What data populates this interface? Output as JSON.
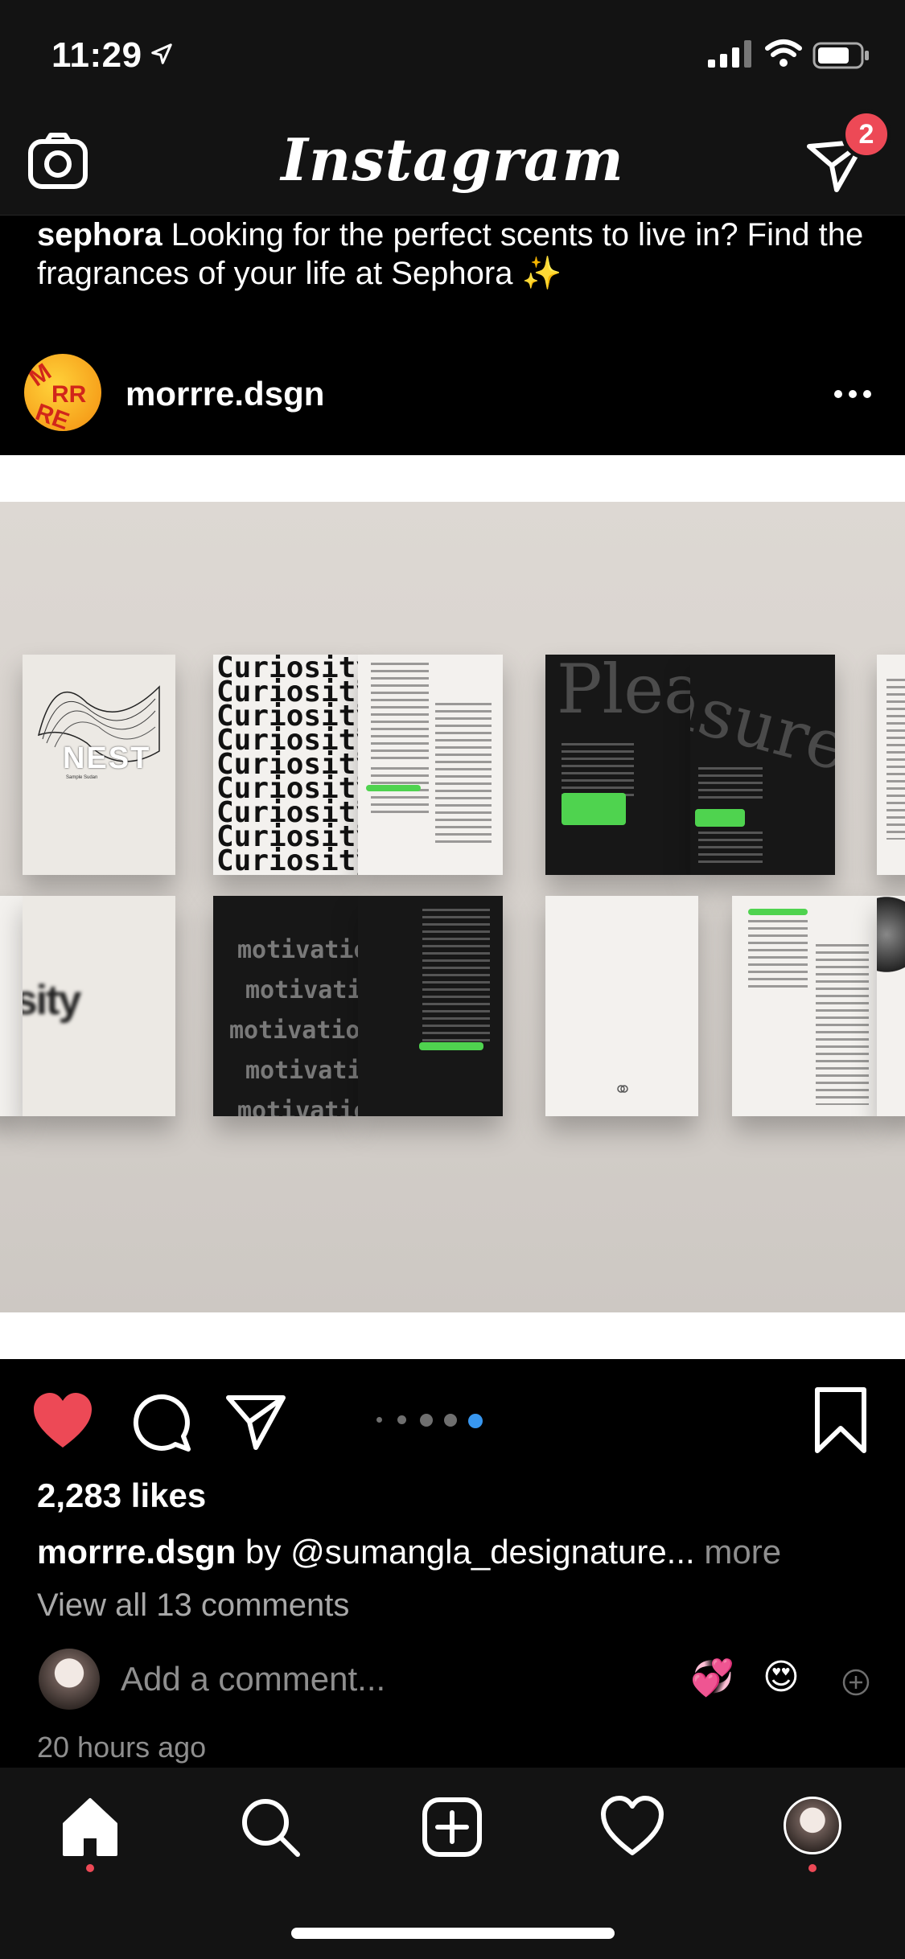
{
  "status_bar": {
    "time": "11:29",
    "icons": [
      "location-arrow-icon",
      "cellular-signal-icon",
      "wifi-icon",
      "battery-icon"
    ]
  },
  "header": {
    "logo": "Instagram",
    "camera_icon": "camera-icon",
    "direct_icon": "paper-plane-icon",
    "direct_badge": "2"
  },
  "previous_post": {
    "username": "sephora",
    "caption": " Looking for the perfect scents to live in? Find the fragrances of your life at Sephora ✨"
  },
  "post": {
    "avatar_text": "MORRRE",
    "username": "morrre.dsgn",
    "more_icon": "more-horizontal-icon",
    "image_text": {
      "cover_title": "NEST",
      "cover_subtitle": "Sample Sudan",
      "curiosity_word": "Curiosity",
      "motivation_word": "motivation",
      "pleasure_word": "Pleasure"
    },
    "carousel": {
      "count": 5,
      "active_index": 4
    },
    "likes": "2,283 likes",
    "caption_username": "morrre.dsgn",
    "caption_text": " by @sumangla_designature...",
    "caption_more": " more",
    "view_comments": "View all 13 comments",
    "comment_placeholder": "Add a comment...",
    "quick_emojis": [
      "💞",
      "😍"
    ],
    "timestamp": "20 hours ago"
  },
  "colors": {
    "like_red": "#ed4956",
    "carousel_active": "#3897f0",
    "highlight_green": "#4fd34f",
    "background": "#000000"
  },
  "tab_bar": {
    "tabs": [
      "home-icon",
      "search-icon",
      "new-post-icon",
      "activity-heart-icon",
      "profile-avatar"
    ]
  }
}
